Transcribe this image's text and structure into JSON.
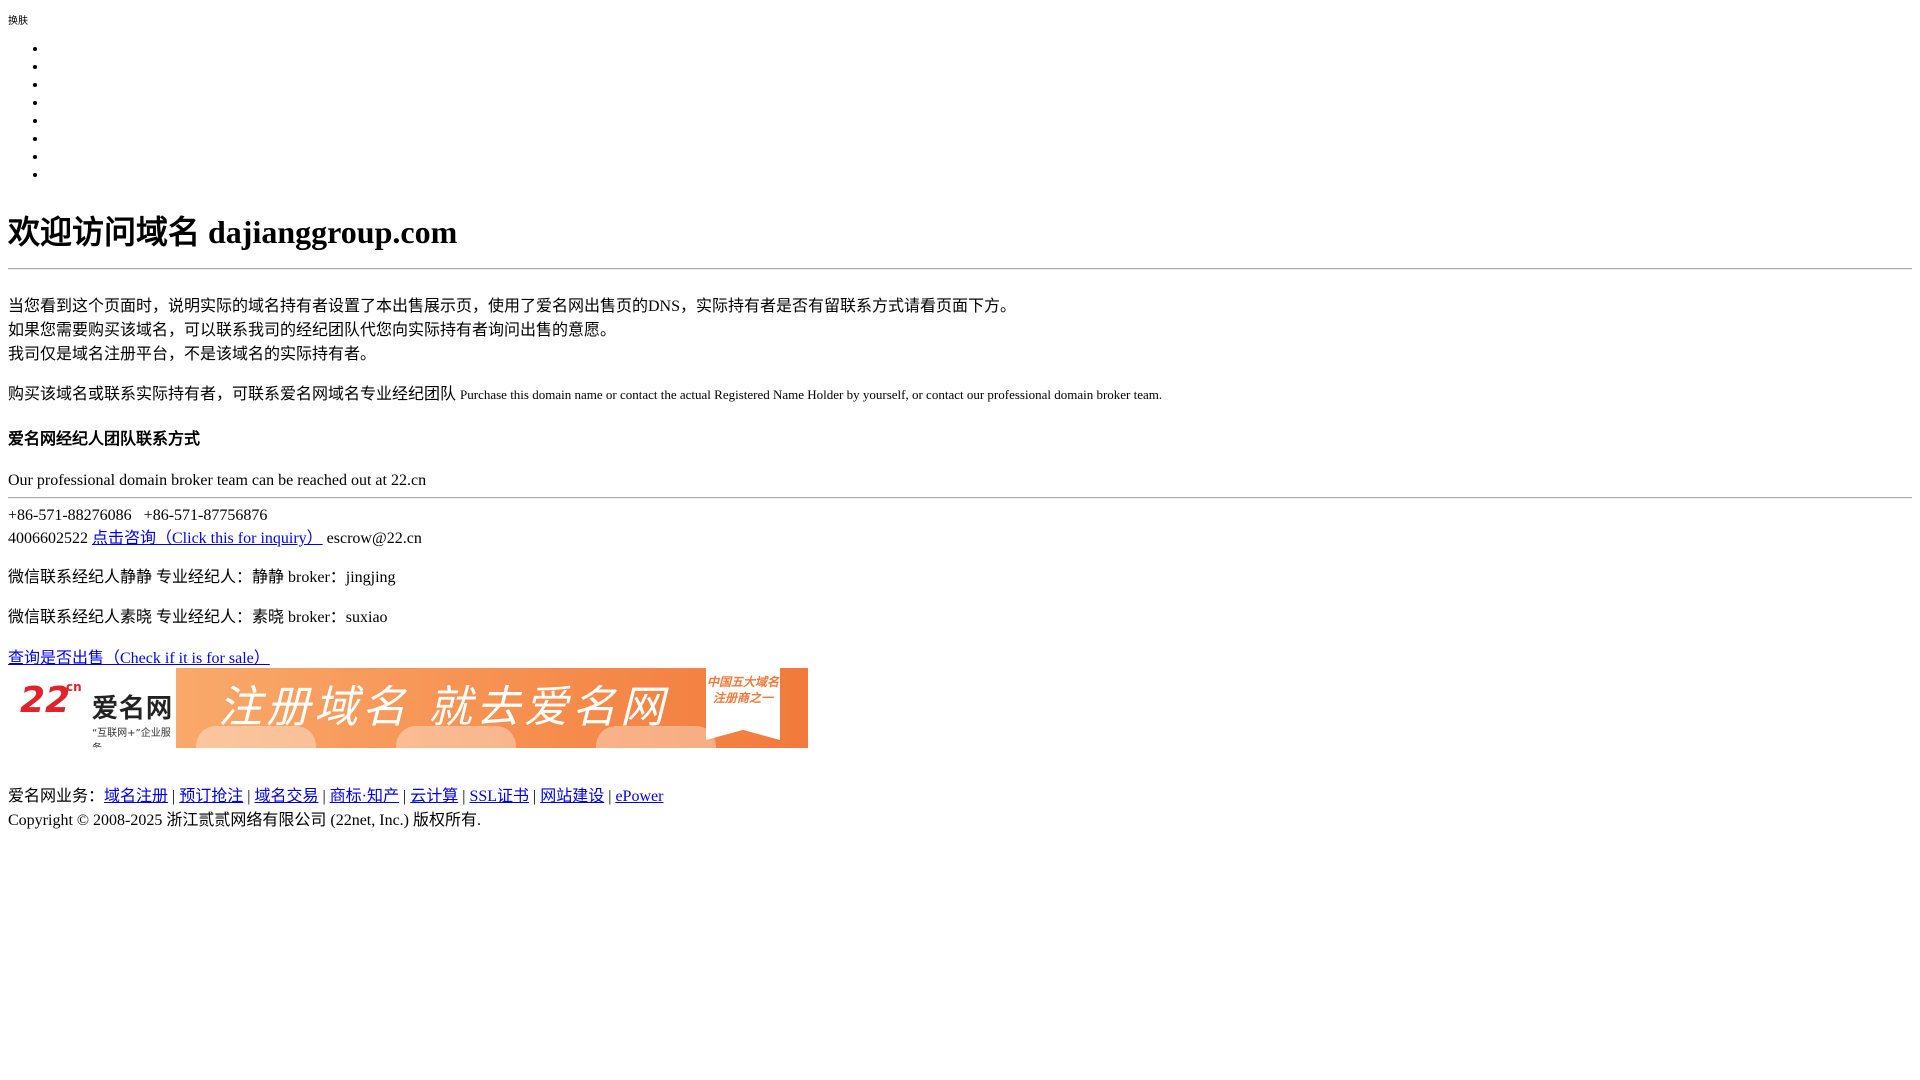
{
  "header": {
    "skin_label": "换肤",
    "bullet_count": 8
  },
  "title": "欢迎访问域名 dajianggroup.com",
  "intro": {
    "line1": "当您看到这个页面时，说明实际的域名持有者设置了本出售展示页，使用了爱名网出售页的DNS，实际持有者是否有留联系方式请看页面下方。",
    "line2": "如果您需要购买该域名，可以联系我司的经纪团队代您向实际持有者询问出售的意愿。",
    "line3": "我司仅是域名注册平台，不是该域名的实际持有者。"
  },
  "buy": {
    "cn": "购买该域名或联系实际持有者，可联系爱名网域名专业经纪团队",
    "en": "Purchase this domain name or contact the actual Registered Name Holder by yourself, or contact our professional domain broker team."
  },
  "team": {
    "heading": "爱名网经纪人团队联系方式",
    "en_note": "Our professional domain broker team can be reached out at 22.cn"
  },
  "contact": {
    "phones": "+86-571-88276086   +86-571-87756876",
    "hotline": "4006602522",
    "inquiry_link": "点击咨询（Click this for inquiry）",
    "email": "escrow@22.cn"
  },
  "brokers": [
    {
      "img_alt": "微信联系经纪人静静",
      "text": "专业经纪人：静静 broker：jingjing"
    },
    {
      "img_alt": "微信联系经纪人素晓",
      "text": "专业经纪人：素晓 broker：suxiao"
    }
  ],
  "check_sale_link": "查询是否出售（Check if it is for sale）",
  "banner": {
    "logo_number": "22",
    "logo_cn": "cn",
    "logo_name": "爱名网",
    "logo_tag": "“互联网+”企业服务",
    "slogan": "注册域名 就去爱名网",
    "badge": "中国五大域名注册商之一",
    "brand_color": "#e0222a",
    "accent_color": "#f68f4f"
  },
  "footer": {
    "prefix": "爱名网业务：",
    "links": [
      "域名注册",
      "预订抢注",
      "域名交易",
      "商标·知产",
      "云计算",
      "SSL证书",
      "网站建设",
      "ePower"
    ],
    "separator": " | ",
    "copyright": "Copyright © 2008-2025 浙江贰贰网络有限公司 (22net, Inc.) 版权所有."
  }
}
